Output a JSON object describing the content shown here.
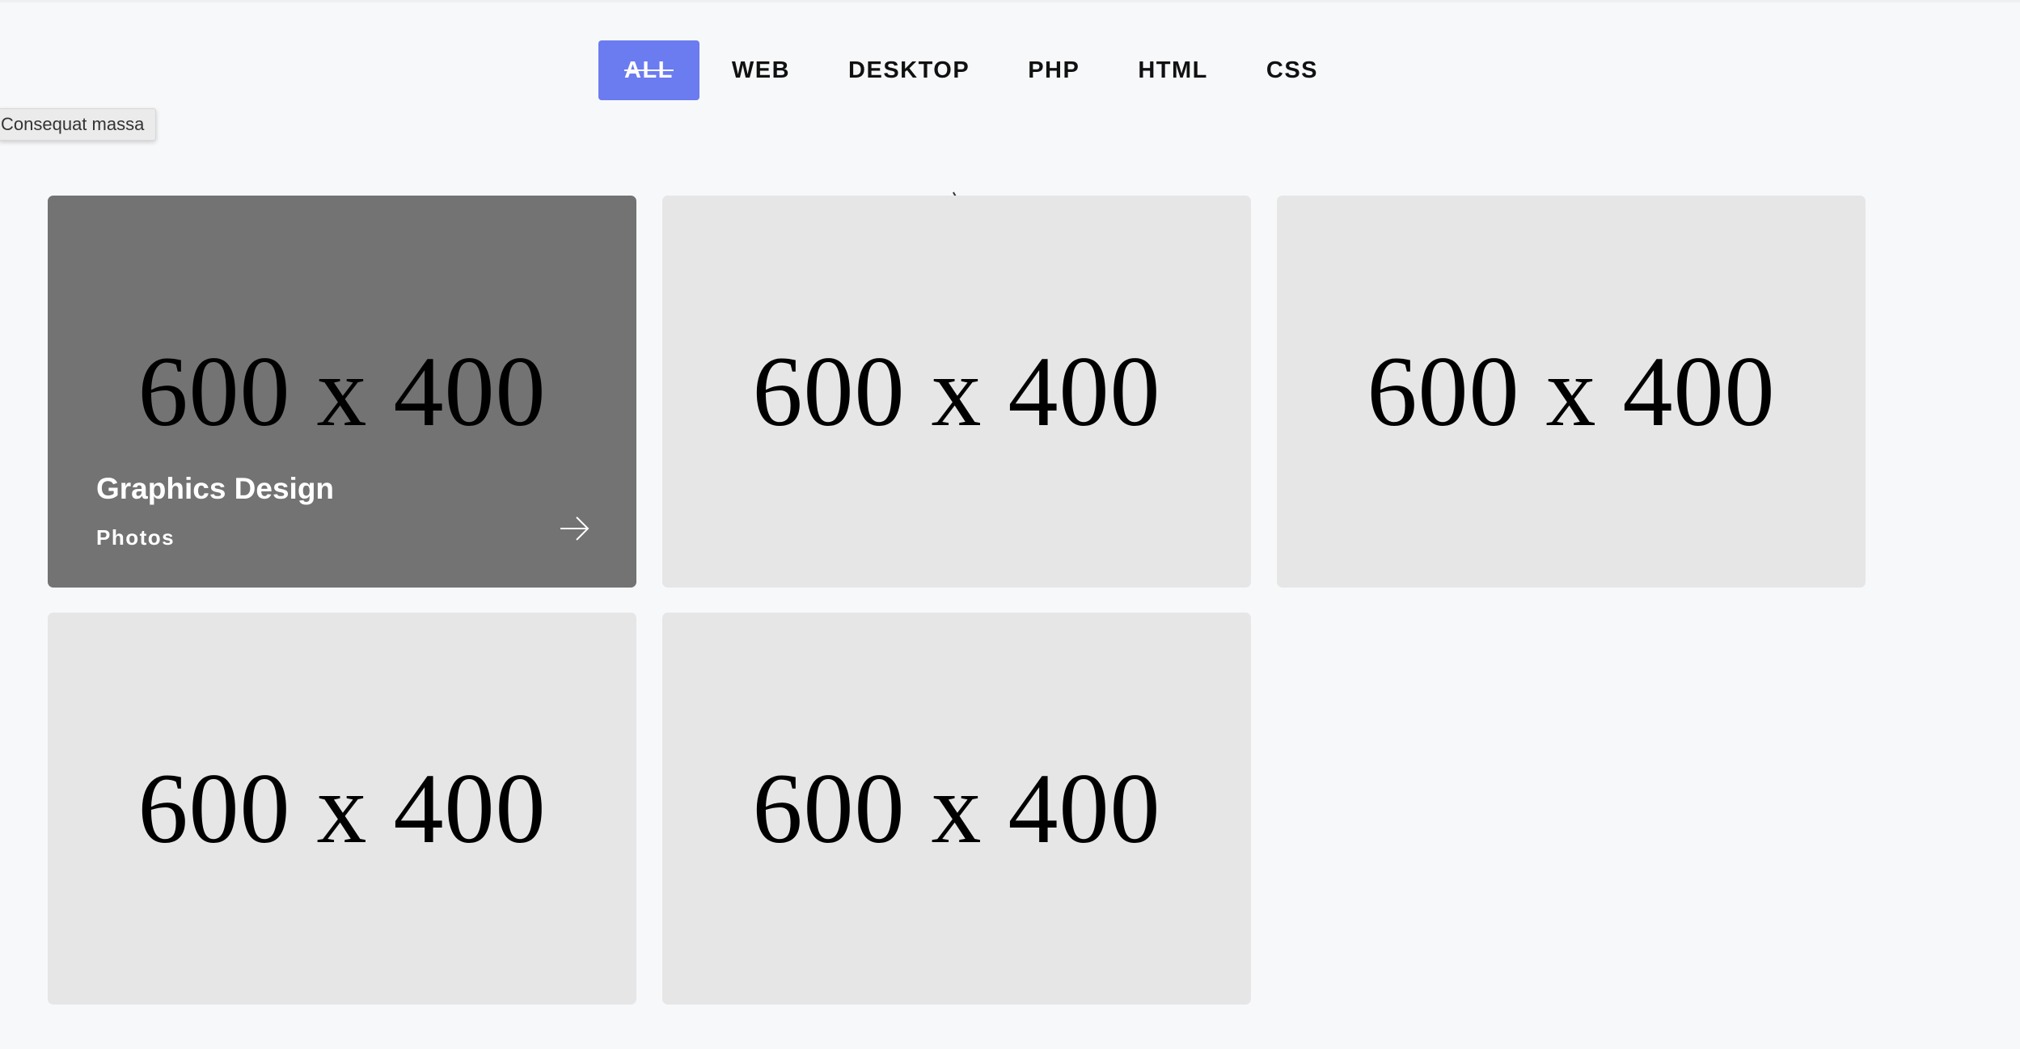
{
  "filters": [
    {
      "label": "ALL",
      "active": true
    },
    {
      "label": "WEB",
      "active": false
    },
    {
      "label": "DESKTOP",
      "active": false
    },
    {
      "label": "PHP",
      "active": false
    },
    {
      "label": "HTML",
      "active": false
    },
    {
      "label": "CSS",
      "active": false
    }
  ],
  "tooltip": {
    "text": "Consequat massa"
  },
  "portfolio": {
    "items": [
      {
        "placeholder": "600 x 400",
        "title": "Graphics Design",
        "category": "Photos"
      },
      {
        "placeholder": "600 x 400"
      },
      {
        "placeholder": "600 x 400"
      },
      {
        "placeholder": "600 x 400"
      },
      {
        "placeholder": "600 x 400"
      }
    ],
    "arrow_icon": "arrow-right-icon"
  },
  "colors": {
    "accent": "#6b7bf0",
    "page_background": "#f7f8fa",
    "card_background": "#e6e6e6",
    "card_hover_overlay": "#737373"
  }
}
